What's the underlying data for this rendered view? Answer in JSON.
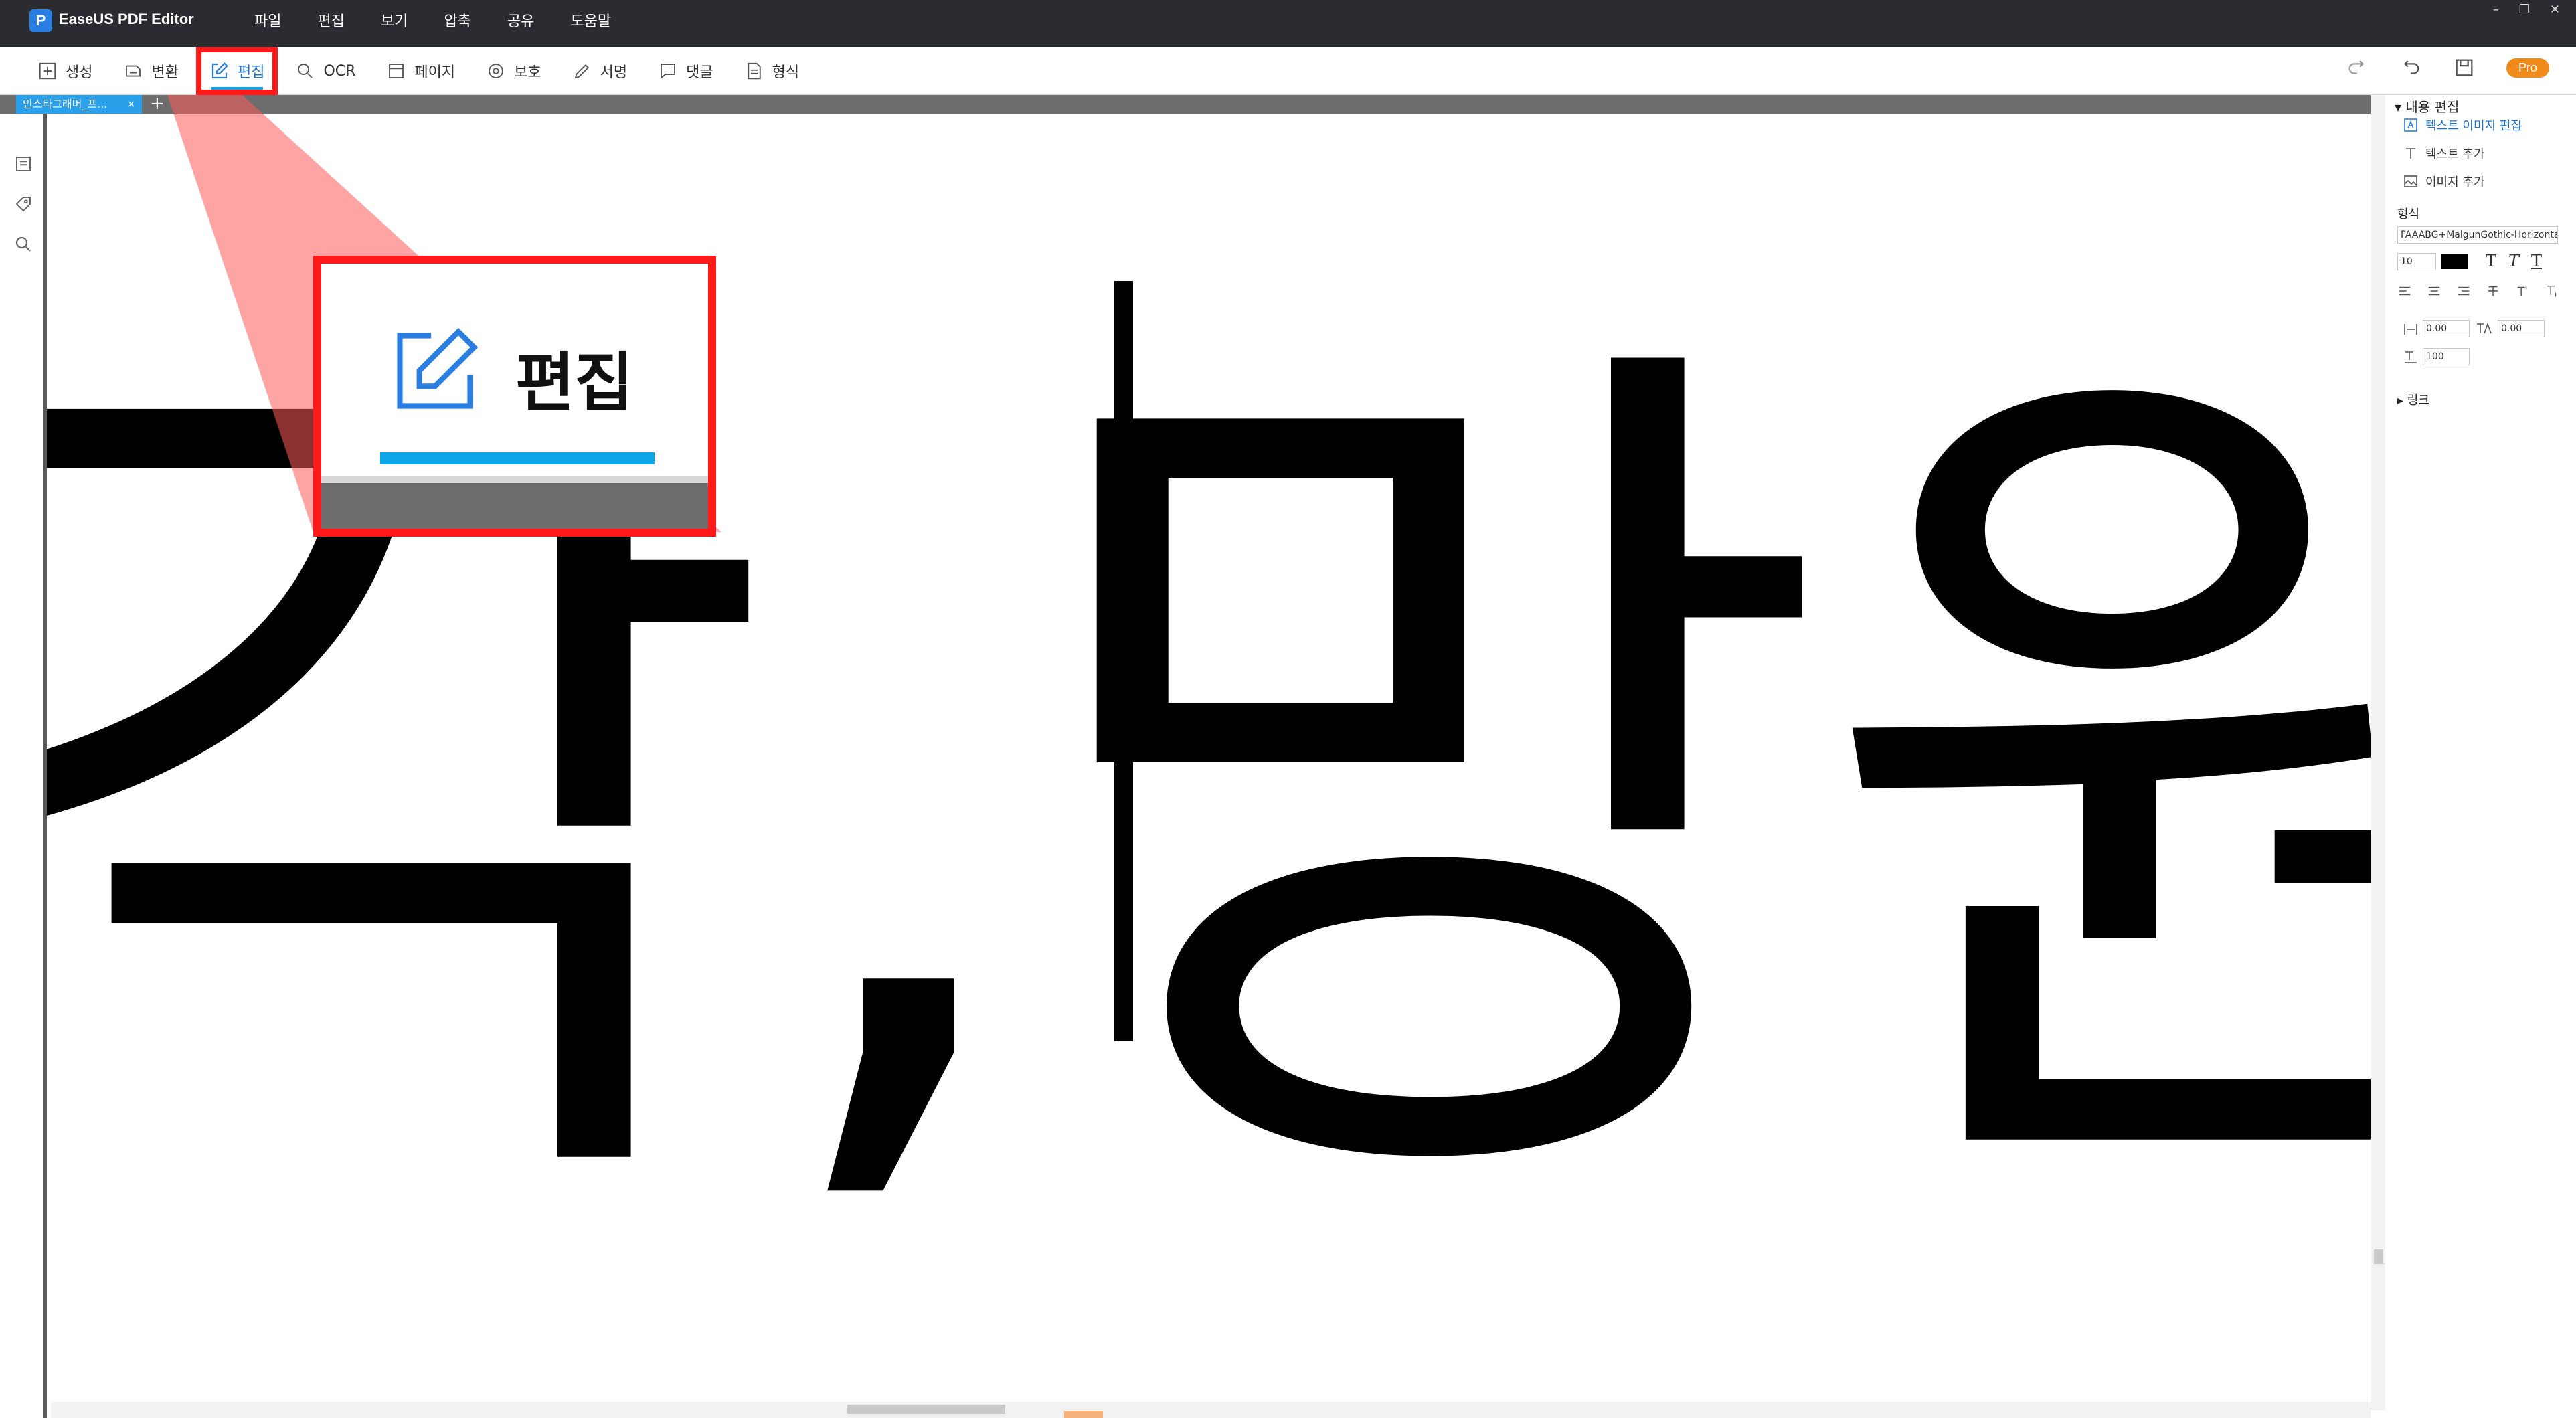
{
  "app": {
    "title": "EaseUS PDF Editor",
    "logo_letter": "P"
  },
  "menu": [
    "파일",
    "편집",
    "보기",
    "압축",
    "공유",
    "도움말"
  ],
  "window_controls": [
    "–",
    "❐",
    "✕"
  ],
  "toolbar": {
    "tools": [
      {
        "label": "생성",
        "icon": "plus-square-icon"
      },
      {
        "label": "변환",
        "icon": "convert-icon"
      },
      {
        "label": "편집",
        "icon": "edit-pencil-icon",
        "active": true
      },
      {
        "label": "OCR",
        "icon": "ocr-icon"
      },
      {
        "label": "페이지",
        "icon": "page-icon"
      },
      {
        "label": "보호",
        "icon": "shield-icon"
      },
      {
        "label": "서명",
        "icon": "pen-icon"
      },
      {
        "label": "댓글",
        "icon": "comment-icon"
      },
      {
        "label": "형식",
        "icon": "form-icon"
      }
    ],
    "pro_label": "Pro"
  },
  "tabs": {
    "doc_tab_label": "인스타그래머_프...",
    "close_symbol": "×",
    "add_symbol": "+"
  },
  "canvas": {
    "page_text": "각,망원)"
  },
  "callout": {
    "label": "편집"
  },
  "panel": {
    "content_edit": {
      "title": "내용 편집",
      "items": [
        {
          "label": "텍스트 이미지 편집",
          "selected": true
        },
        {
          "label": "텍스트 추가",
          "selected": false
        },
        {
          "label": "이미지 추가",
          "selected": false
        }
      ]
    },
    "format": {
      "title": "형식",
      "font_name": "FAAABG+MalgunGothic-Horizontal",
      "font_size": "10",
      "text_color": "#000000",
      "char_spacing": "0.00",
      "word_spacing": "0.00",
      "scale": "100"
    },
    "link": {
      "title": "링크"
    }
  },
  "colors": {
    "accent": "#0ea5e9",
    "highlight": "#ff1a1a",
    "titlebar": "#2b2c31",
    "pro": "#f08a1a"
  }
}
